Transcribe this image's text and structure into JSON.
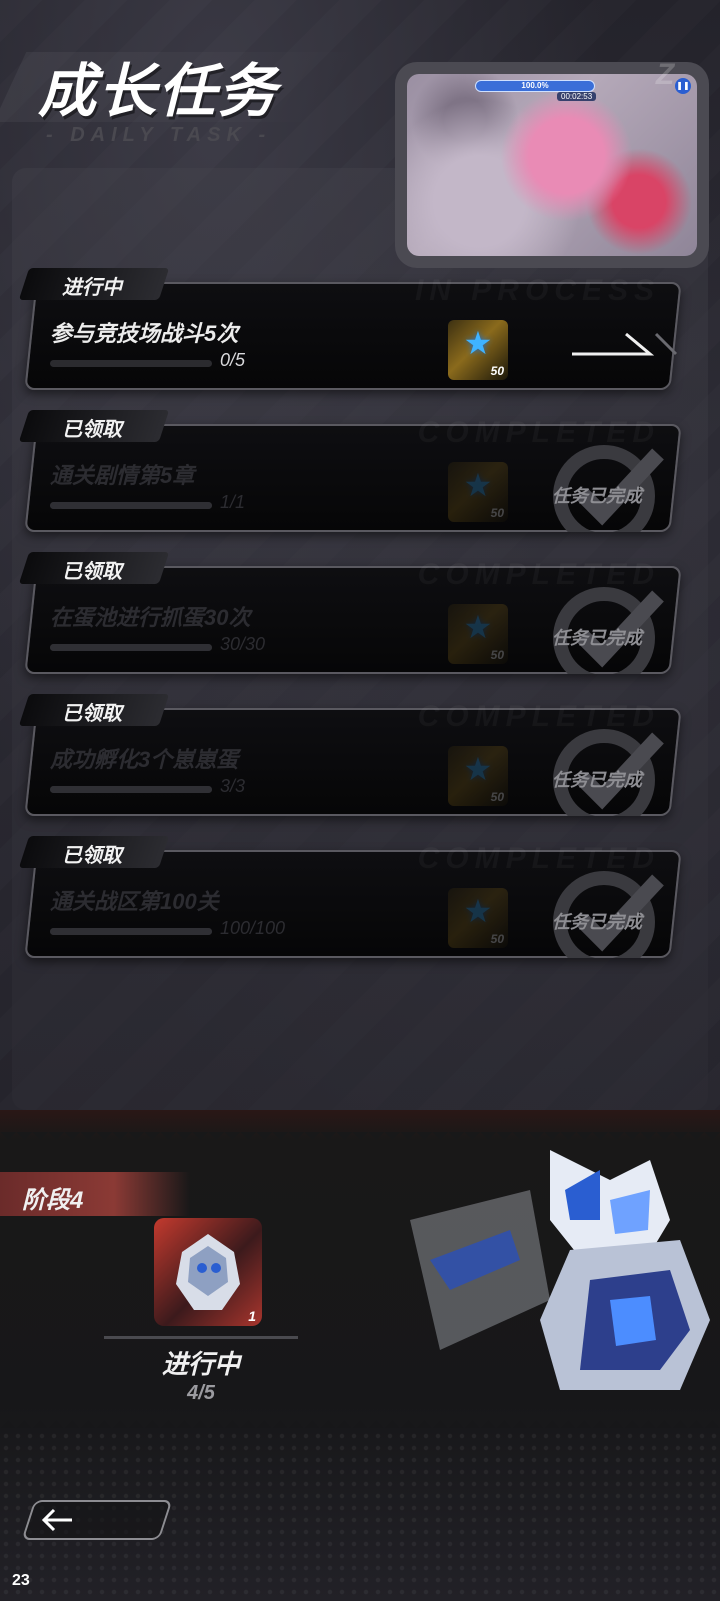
{
  "header": {
    "title": "成长任务",
    "subtitle": "- DAILY TASK -"
  },
  "video": {
    "hud_progress": "100.0%",
    "hud_timer": "00:02:53"
  },
  "tasks": [
    {
      "tag": "进行中",
      "name": "参与竞技场战斗5次",
      "progress_text": "0/5",
      "progress": 0,
      "reward_qty": "50",
      "reward_icon": "blue-star-icon",
      "status": "in_progress"
    },
    {
      "tag": "已领取",
      "name": "通关剧情第5章",
      "progress_text": "1/1",
      "progress": 1,
      "reward_qty": "50",
      "reward_icon": "blue-star-icon",
      "status": "claimed",
      "done_label": "任务已完成"
    },
    {
      "tag": "已领取",
      "name": "在蛋池进行抓蛋30次",
      "progress_text": "30/30",
      "progress": 1,
      "reward_qty": "50",
      "reward_icon": "blue-star-icon",
      "status": "claimed",
      "done_label": "任务已完成"
    },
    {
      "tag": "已领取",
      "name": "成功孵化3个崽崽蛋",
      "progress_text": "3/3",
      "progress": 1,
      "reward_qty": "50",
      "reward_icon": "blue-star-icon",
      "status": "claimed",
      "done_label": "任务已完成"
    },
    {
      "tag": "已领取",
      "name": "通关战区第100关",
      "progress_text": "100/100",
      "progress": 1,
      "reward_qty": "50",
      "reward_icon": "blue-star-icon",
      "status": "claimed",
      "done_label": "任务已完成"
    }
  ],
  "stage": {
    "label": "阶段4",
    "reward_count": "1",
    "status": "进行中",
    "progress_text": "4/5",
    "progress": 0.8
  },
  "nav": {
    "back_icon": "arrow-left-icon"
  },
  "corner_number": "23",
  "colors": {
    "accent_blue": "#3fb3ff",
    "stage_red": "#8b3a35",
    "background": "#1b1a1f"
  }
}
